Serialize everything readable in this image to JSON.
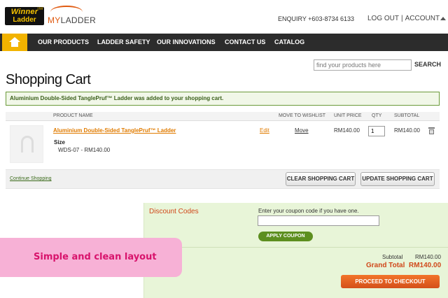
{
  "header": {
    "logo_winner_line1": "Winner",
    "logo_winner_line2": "Ladder",
    "logo_winner_tm": "TM",
    "logo_myladder_prefix": "MY",
    "logo_myladder_suffix": "LADDER",
    "enquiry": "ENQUIRY +603-8734 6133",
    "logout": "LOG OUT",
    "separator": "|",
    "account": "ACCOUNT"
  },
  "nav": {
    "items": [
      {
        "label": "OUR PRODUCTS"
      },
      {
        "label": "LADDER SAFETY"
      },
      {
        "label": "OUR INNOVATIONS"
      },
      {
        "label": "CONTACT US"
      },
      {
        "label": "CATALOG"
      }
    ]
  },
  "search": {
    "placeholder": "find your products here",
    "button": "SEARCH"
  },
  "page": {
    "title": "Shopping Cart",
    "success_message": "Aluminium Double-Sided TanglePruf™ Ladder was added to your shopping cart."
  },
  "cart": {
    "columns": [
      "PRODUCT NAME",
      "MOVE TO WISHLIST",
      "UNIT PRICE",
      "QTY",
      "SUBTOTAL"
    ],
    "item": {
      "name": "Aluminium Double-Sided TanglePruf™ Ladder",
      "option_label": "Size",
      "option_value": "WDS-07 - RM140.00",
      "edit": "Edit",
      "move": "Move",
      "unit_price": "RM140.00",
      "qty": "1",
      "subtotal": "RM140.00"
    },
    "continue": "Continue Shopping",
    "clear": "CLEAR SHOPPING CART",
    "update": "UPDATE SHOPPING CART"
  },
  "discount": {
    "title": "Discount Codes",
    "hint": "Enter your coupon code if you have one.",
    "code": "",
    "apply": "APPLY COUPON"
  },
  "totals": {
    "subtotal_label": "Subtotal",
    "subtotal_value": "RM140.00",
    "grand_label": "Grand Total",
    "grand_value": "RM140.00",
    "checkout": "PROCEED TO CHECKOUT"
  },
  "callout": {
    "text": "Simple and clean layout"
  },
  "colors": {
    "accent_orange": "#e07b00",
    "nav_bg": "#2c2c2c",
    "home_yellow": "#f2b300",
    "panel_green": "#e8f5d8",
    "grand_total_red": "#d0481a",
    "callout_pink": "#f7b1d6"
  }
}
